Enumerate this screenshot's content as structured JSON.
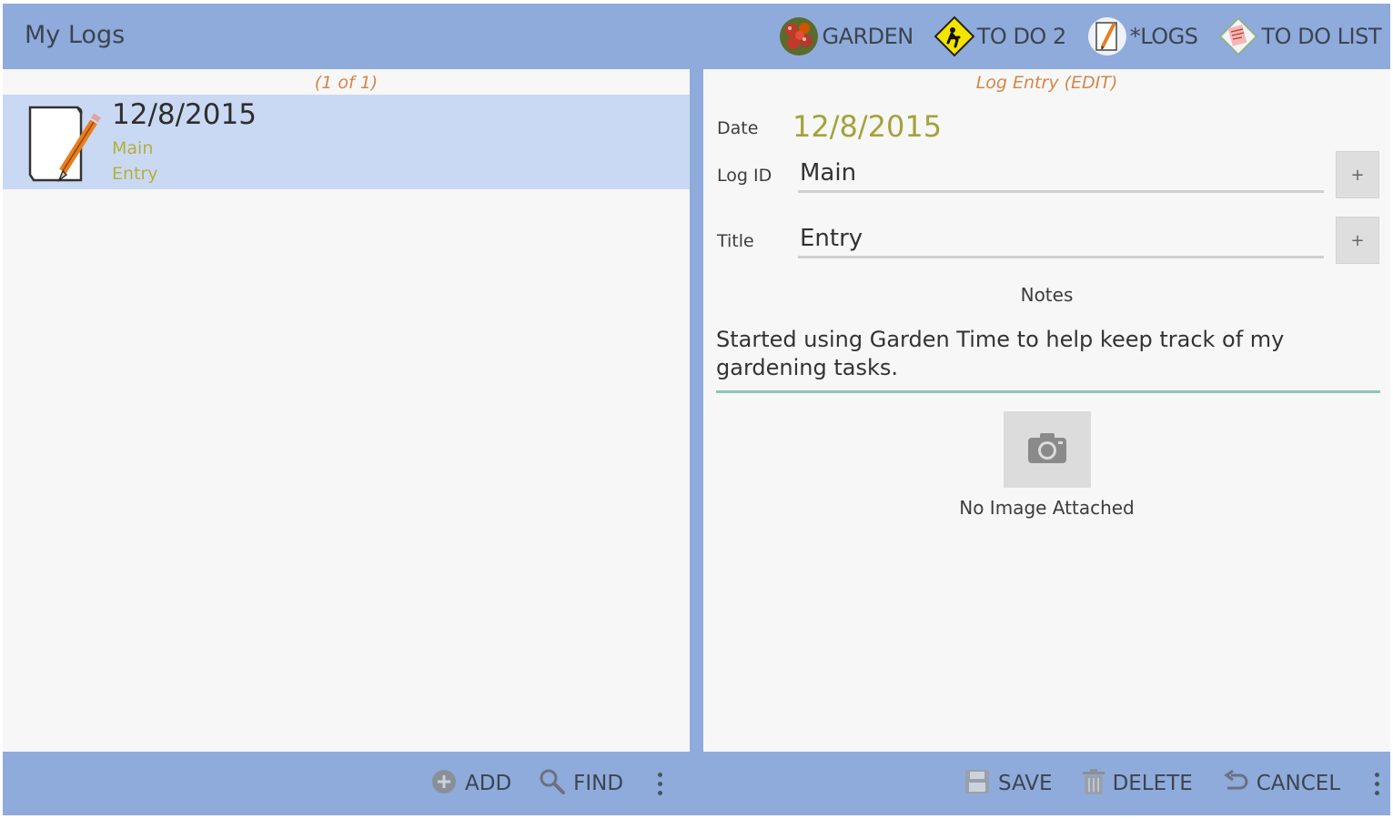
{
  "app": {
    "title": "My Logs"
  },
  "nav": [
    {
      "label": "GARDEN",
      "icon": "tomato-cluster-icon"
    },
    {
      "label": "TO DO 2",
      "icon": "gardener-sign-icon"
    },
    {
      "label": "*LOGS",
      "icon": "notepad-pencil-icon"
    },
    {
      "label": "TO DO LIST",
      "icon": "list-note-icon"
    }
  ],
  "list": {
    "counter": "(1 of 1)",
    "items": [
      {
        "date": "12/8/2015",
        "log_id": "Main",
        "title": "Entry",
        "icon": "notepad-pencil-icon"
      }
    ]
  },
  "form": {
    "heading": "Log Entry (EDIT)",
    "date_label": "Date",
    "date_value": "12/8/2015",
    "logid_label": "Log ID",
    "logid_value": "Main",
    "title_label": "Title",
    "title_value": "Entry",
    "plus": "+",
    "notes_label": "Notes",
    "notes_value": "Started using Garden Time to help keep track of my gardening tasks.",
    "no_image": "No Image Attached"
  },
  "bottom": {
    "add": "ADD",
    "find": "FIND",
    "save": "SAVE",
    "delete": "DELETE",
    "cancel": "CANCEL"
  },
  "colors": {
    "bar": "#8fabdb",
    "selected_row": "#cad9f3",
    "accent_orange": "#d4864a",
    "accent_olive": "#a2a33a",
    "notes_underline": "#8ec5b8"
  }
}
